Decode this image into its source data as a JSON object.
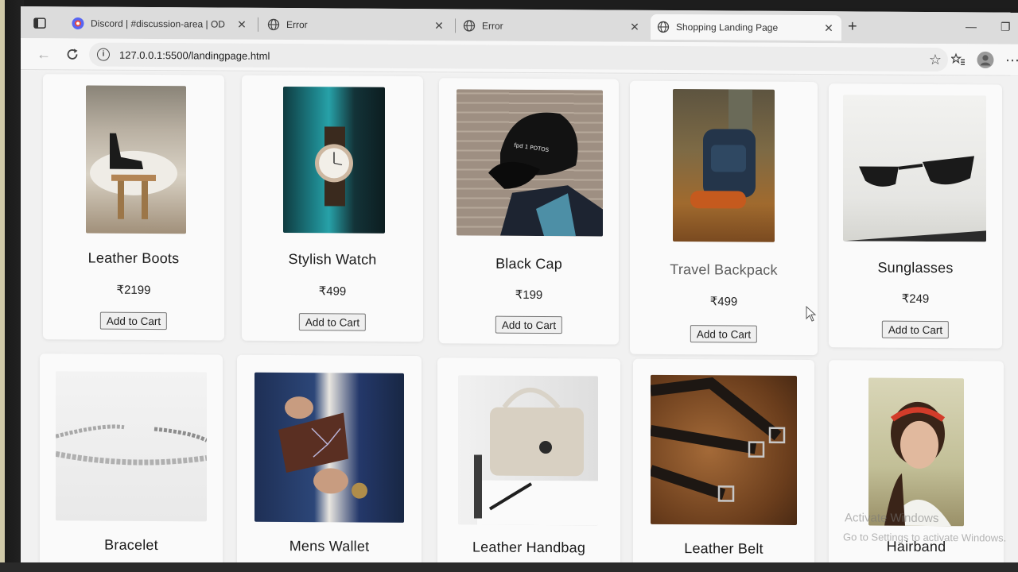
{
  "browser": {
    "tabs": [
      {
        "label": "Discord | #discussion-area | OD",
        "icon": "discord-icon",
        "active": false
      },
      {
        "label": "Error",
        "icon": "globe-icon",
        "active": false
      },
      {
        "label": "Error",
        "icon": "globe-icon",
        "active": false
      },
      {
        "label": "Shopping Landing Page",
        "icon": "globe-icon",
        "active": true
      }
    ],
    "new_tab": "+",
    "url": "127.0.0.1:5500/landingpage.html"
  },
  "products": [
    {
      "name": "Leather Boots",
      "price": "₹2199",
      "button": "Add to Cart"
    },
    {
      "name": "Stylish Watch",
      "price": "₹499",
      "button": "Add to Cart"
    },
    {
      "name": "Black Cap",
      "price": "₹199",
      "button": "Add to Cart"
    },
    {
      "name": "Travel Backpack",
      "price": "₹499",
      "button": "Add to Cart"
    },
    {
      "name": "Sunglasses",
      "price": "₹249",
      "button": "Add to Cart"
    },
    {
      "name": "Bracelet"
    },
    {
      "name": "Mens Wallet"
    },
    {
      "name": "Leather Handbag"
    },
    {
      "name": "Leather Belt"
    },
    {
      "name": "Hairband"
    }
  ],
  "overlay": {
    "activate_title": "Activate Windows",
    "activate_sub": "Go to Settings to activate Windows."
  }
}
